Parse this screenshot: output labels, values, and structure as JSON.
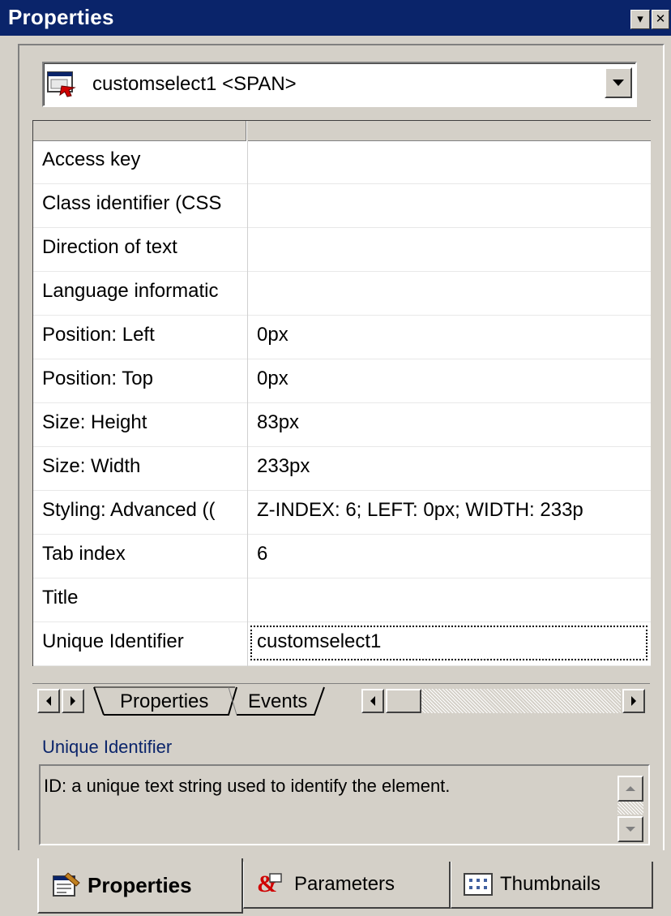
{
  "window": {
    "title": "Properties",
    "buttons": [
      "▾",
      "✕"
    ]
  },
  "selector": {
    "icon": "element-icon",
    "value": "customselect1 <SPAN>"
  },
  "grid": {
    "rows": [
      {
        "name": "Access key",
        "value": ""
      },
      {
        "name": "Class identifier (CSS",
        "value": ""
      },
      {
        "name": "Direction of text",
        "value": ""
      },
      {
        "name": "Language informatic",
        "value": ""
      },
      {
        "name": "Position: Left",
        "value": "0px"
      },
      {
        "name": "Position: Top",
        "value": "0px"
      },
      {
        "name": "Size: Height",
        "value": "83px"
      },
      {
        "name": "Size: Width",
        "value": "233px"
      },
      {
        "name": "Styling: Advanced ((",
        "value": "Z-INDEX: 6; LEFT: 0px; WIDTH: 233p"
      },
      {
        "name": "Tab index",
        "value": "6"
      },
      {
        "name": "Title",
        "value": ""
      },
      {
        "name": "Unique Identifier",
        "value": "customselect1"
      }
    ],
    "focused_row": 11
  },
  "sheet_tabs": {
    "tabs": [
      "Properties",
      "Events"
    ],
    "active": 0
  },
  "description": {
    "title": "Unique Identifier",
    "text": "ID: a unique text string used to identify the element."
  },
  "bottom_tabs": [
    {
      "label": "Properties",
      "icon": "properties-icon",
      "active": true
    },
    {
      "label": "Parameters",
      "icon": "parameters-icon",
      "active": false
    },
    {
      "label": "Thumbnails",
      "icon": "thumbnails-icon",
      "active": false
    }
  ],
  "colors": {
    "titlebar": "#0a246a",
    "face": "#d4d0c8",
    "description_title": "#0a246a"
  }
}
